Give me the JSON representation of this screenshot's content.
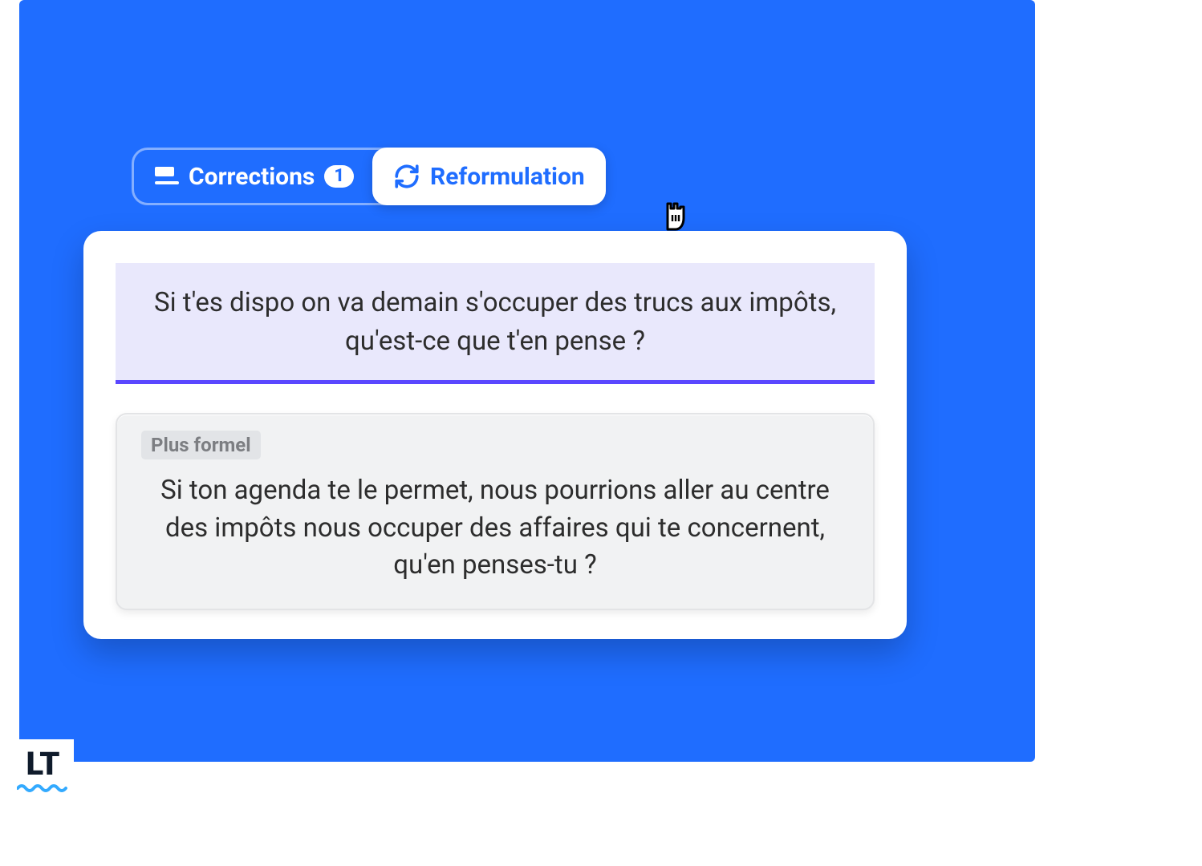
{
  "tabs": {
    "corrections": {
      "label": "Corrections",
      "count": "1"
    },
    "reformulation": {
      "label": "Reformulation"
    }
  },
  "content": {
    "original_text": "Si t'es dispo on va demain s'occuper des trucs aux impôts, qu'est-ce que t'en pense ?",
    "suggestion_label": "Plus formel",
    "suggestion_text": "Si ton agenda te le permet, nous pourrions aller au centre des impôts  nous occuper des affaires qui te concernent, qu'en penses-tu ?"
  },
  "branding": {
    "logo_text": "LT"
  },
  "colors": {
    "primary": "#1f6dff",
    "accent_underline": "#5a47ff",
    "highlight_bg": "#e9e8fc"
  }
}
